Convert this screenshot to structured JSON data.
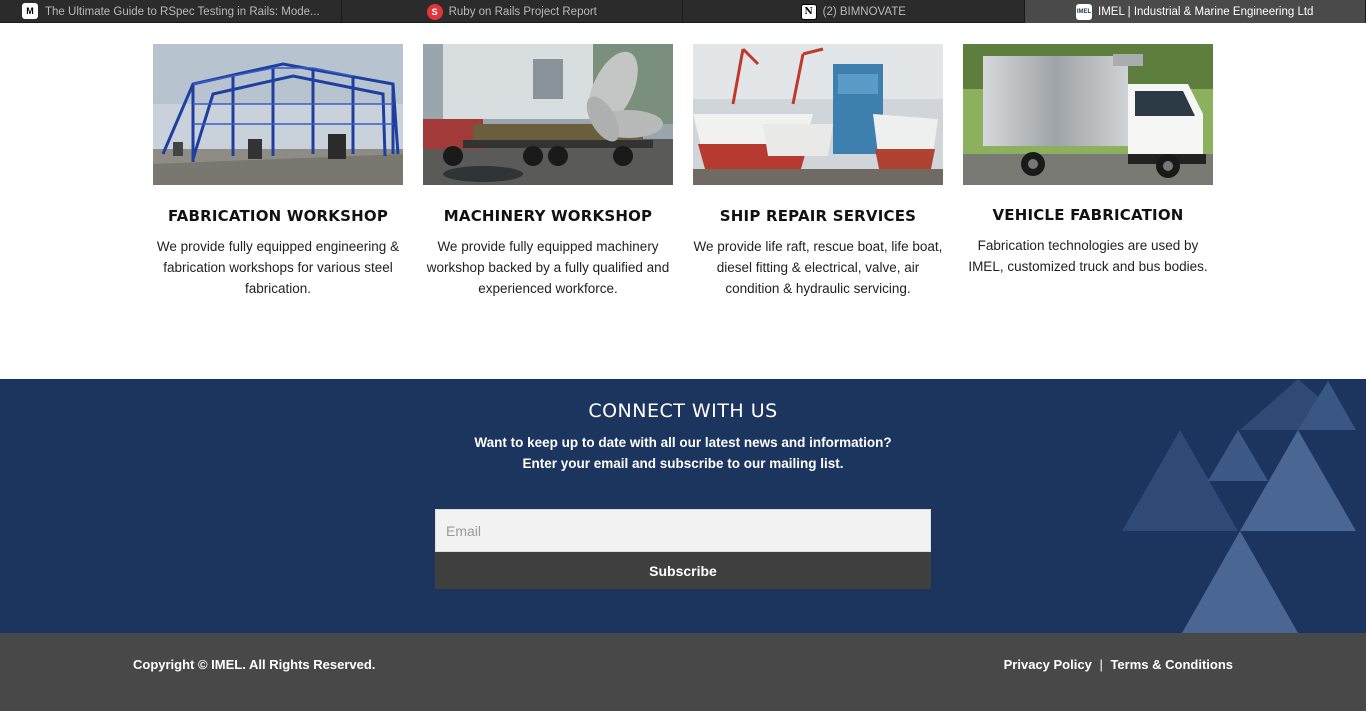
{
  "browser": {
    "tabs": [
      {
        "title": "The Ultimate Guide to RSpec Testing in Rails: Mode...",
        "favicon": "M",
        "active": false
      },
      {
        "title": "Ruby on Rails Project Report",
        "favicon": "S",
        "active": false
      },
      {
        "title": "(2) BIMNOVATE",
        "favicon": "N",
        "active": false
      },
      {
        "title": "IMEL | Industrial & Marine Engineering Ltd",
        "favicon": "IMEL",
        "active": true
      }
    ]
  },
  "services": [
    {
      "title": "FABRICATION WORKSHOP",
      "description": "We provide fully equipped engineering & fabrication workshops for various steel fabrication.",
      "image": "steel-frame-building-photo"
    },
    {
      "title": "MACHINERY WORKSHOP",
      "description": "We provide fully equipped machinery workshop backed by a fully qualified and experienced workforce.",
      "image": "ship-propeller-truck-photo"
    },
    {
      "title": "SHIP REPAIR SERVICES",
      "description": "We provide life raft, rescue boat, life boat, diesel fitting & electrical, valve, air condition & hydraulic servicing.",
      "image": "ships-drydock-photo"
    },
    {
      "title": "VEHICLE FABRICATION",
      "description": "Fabrication technologies are used by IMEL, customized truck and bus bodies.",
      "image": "box-truck-photo"
    }
  ],
  "connect": {
    "heading": "CONNECT WITH US",
    "line1": "Want to keep up to date with all our latest news and information?",
    "line2": "Enter your email and subscribe to our mailing list.",
    "email_placeholder": "Email",
    "subscribe_label": "Subscribe"
  },
  "footer": {
    "copyright": "Copyright © IMEL. All Rights Reserved.",
    "privacy": "Privacy Policy",
    "separator": "|",
    "terms": "Terms & Conditions"
  },
  "colors": {
    "brand_navy": "#1b355e",
    "footer_gray": "#484848",
    "button_gray": "#3f3f3f"
  }
}
